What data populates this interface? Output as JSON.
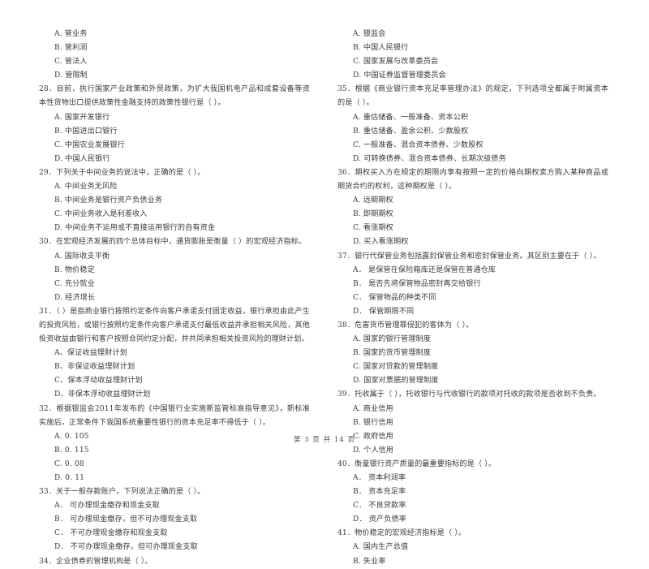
{
  "document": {
    "footer": "第 3 页  共 14 页"
  },
  "left_column": {
    "leading_options": [
      "A. 管业务",
      "B. 管利润",
      "C. 管法人",
      "D. 管限制"
    ],
    "questions": [
      {
        "number": "28",
        "stem": "28．目前，执行国家产业政策和外贸政策，为扩大我国机电产品和成套设备等资本性货物出口提供政策性金融支持的政策性银行是（        ）。",
        "options": [
          "A. 国家开发银行",
          "B. 中国进出口银行",
          "C. 中国农业发展银行",
          "D. 中国人民银行"
        ]
      },
      {
        "number": "29",
        "stem": "29．下列关于中间业务的说法中，正确的是（        ）。",
        "options": [
          "A. 中间业务无风险",
          "B. 中间业务是银行资产负债业务",
          "C. 中间业务收入是利差收入",
          "D. 中间业务不运用或不直接运用银行的自有资金"
        ]
      },
      {
        "number": "30",
        "stem": "30．在宏观经济发展的四个总体目标中，通货膨胀是衡量（        ）的宏观经济指标。",
        "options": [
          "A. 国际收支平衡",
          "B. 物价稳定",
          "C. 充分就业",
          "D. 经济增长"
        ]
      },
      {
        "number": "31",
        "stem": "31．（        ）是指商业银行按照约定条件向客户承诺支付固定收益，银行承担由此产生的投资风险，或银行按照约定条件向客户承诺支付最低收益并承担相关风险，其他投资收益由银行和客户按照合同约定分配，并共同承担相关投资风险的理财计划。",
        "options": [
          "A、保证收益理财计划",
          "B、非保证收益理财计划",
          "C、保本浮动收益理财计划",
          "D、非保本浮动收益理财计划"
        ]
      },
      {
        "number": "32",
        "stem": "32．根据银监会2011年发布的《中国银行业实施新监管标准指导意见》，新标准实施后，正常条件下我国系统重要性银行的资本充足率不得低于（        ）。",
        "options": [
          "A. 0. 105",
          "B. 0. 115",
          "C. 0. 08",
          "D. 0. 11"
        ]
      },
      {
        "number": "33",
        "stem": "33．关于一般存款账户，下列说法正确的是（        ）。",
        "options": [
          "A． 可办理现金缴存和现金支取",
          "B． 可办理现金缴存，但不可办理现金支取",
          "C． 不可办理现金缴存和现金支取",
          "D． 不可办理现金缴存，但可办理现金支取"
        ]
      },
      {
        "number": "34",
        "stem": "34．企业债券的管理机构是（        ）。",
        "options": []
      }
    ]
  },
  "right_column": {
    "leading_options": [
      "A. 银监会",
      "B. 中国人民银行",
      "C. 国家发展与改革委员会",
      "D. 中国证券监督管理委员会"
    ],
    "questions": [
      {
        "number": "35",
        "stem": "35．根据《商业银行资本充足率管理办法》的规定，下列选项全都属于附属资本的是（        ）。",
        "options": [
          "A. 重估储备、一般准备、资本公积",
          "B. 重估储备、盈余公积、少数股权",
          "C. 一般准备、混合资本债券、少数股权",
          "D. 可转换债券、混合资本债券、长期次级债务"
        ]
      },
      {
        "number": "36",
        "stem": "36．期权买入方在规定的期限内享有按照一定的价格向期权卖方购入某种商品或期货合约的权利，这种期权是（        ）。",
        "options": [
          "A. 远期期权",
          "B. 即期期权",
          "C. 看涨期权",
          "D. 买入看涨期权"
        ]
      },
      {
        "number": "37",
        "stem": "37．银行代保管业务包括露封保管业务和密封保管业务。其区别主要在于（        ）。",
        "options": [
          "A． 是保管在保险箱库还是保管在普通仓库",
          "B． 是否先将保管物品密封再交给银行",
          "C． 保管物品的种类不同",
          "D． 保管期限不同"
        ]
      },
      {
        "number": "38",
        "stem": "38．危害货币管理罪侵犯的客体为（        ）。",
        "options": [
          "A. 国家的银行管理制度",
          "B. 国家的货币管理制度",
          "C. 国家对贷款的管理制度",
          "D. 国家对票据的管理制度"
        ]
      },
      {
        "number": "39",
        "stem": "39．托收属于（        ），托收银行与代收银行的款项对托收的款项是否收到不负责。",
        "options": [
          "A. 商业信用",
          "B. 银行信用",
          "C. 政府信用",
          "D. 个人信用"
        ]
      },
      {
        "number": "40",
        "stem": "40．衡量银行资产质量的最重要指标的是（        ）。",
        "options": [
          "A． 资本利润率",
          "B． 资本充足率",
          "C． 不良贷款率",
          "D． 资产负债率"
        ]
      },
      {
        "number": "41",
        "stem": "41．物价稳定的宏观经济指标是（        ）。",
        "options": [
          "A. 国内生产总值",
          "B. 失业率"
        ]
      }
    ]
  }
}
